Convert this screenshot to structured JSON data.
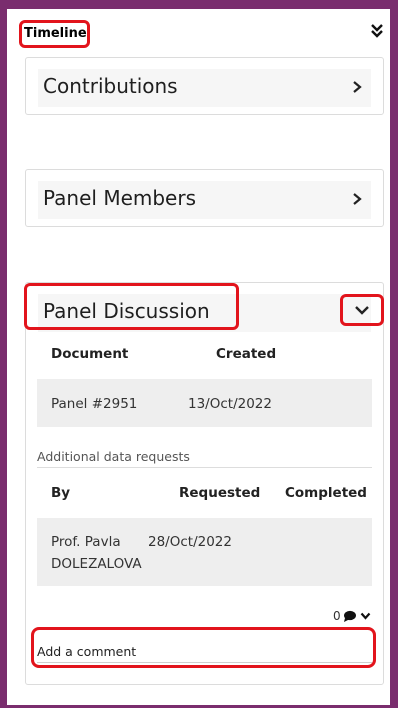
{
  "header": {
    "title": "Timeline",
    "collapse_icon": "double-chevron-down-icon"
  },
  "sections": {
    "contributions": {
      "title": "Contributions",
      "icon": "chevron-right-icon"
    },
    "panel_members": {
      "title": "Panel Members",
      "icon": "chevron-right-icon"
    },
    "panel_discussion": {
      "title": "Panel Discussion",
      "icon": "chevron-down-icon",
      "documents_table": {
        "columns": [
          "Document",
          "Created"
        ],
        "rows": [
          [
            "Panel #2951",
            "13/Oct/2022"
          ]
        ]
      },
      "requests_label": "Additional data requests",
      "requests_table": {
        "columns": [
          "By",
          "Requested",
          "Completed"
        ],
        "rows": [
          [
            "Prof. Pavla",
            "DOLEZALOVA",
            "28/Oct/2022",
            ""
          ]
        ]
      },
      "comments": {
        "count": "0",
        "icon": "comment-icon",
        "toggle_icon": "chevron-down-icon"
      },
      "comment_input": {
        "placeholder": "Add a comment"
      }
    }
  },
  "colors": {
    "frame": "#7a2d6e",
    "highlight": "#e2141c",
    "row_bg": "#eeeeee",
    "head_bg": "#f6f6f6"
  }
}
